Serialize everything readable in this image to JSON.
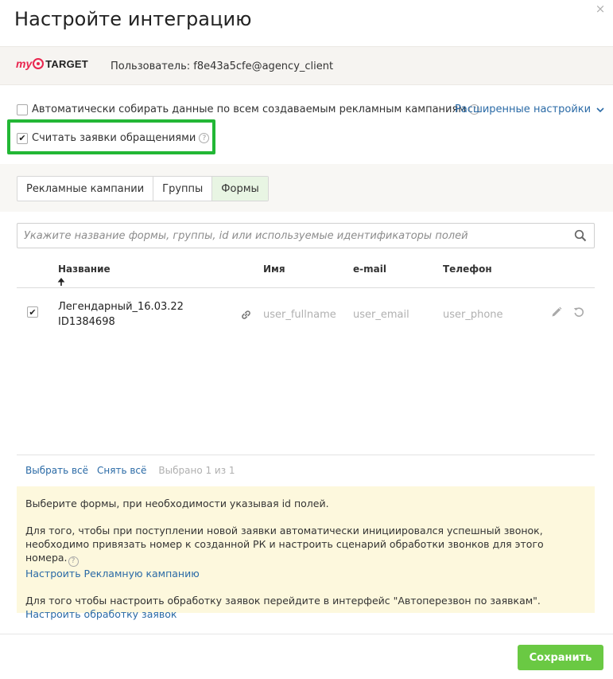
{
  "dialog": {
    "title": "Настройте интеграцию",
    "close": "×"
  },
  "account": {
    "logo_my": "my",
    "logo_target": "TARGET",
    "user_label": "Пользователь: f8e43a5cfe@agency_client"
  },
  "options": {
    "auto_collect": {
      "label": "Автоматически собирать данные по всем создаваемым рекламным кампаниям",
      "checked": false
    },
    "advanced_link": "Расширенные настройки",
    "count_leads": {
      "label": "Считать заявки обращениями",
      "checked": true
    }
  },
  "tabs": [
    {
      "label": "Рекламные кампании",
      "active": false
    },
    {
      "label": "Группы",
      "active": false
    },
    {
      "label": "Формы",
      "active": true
    }
  ],
  "search": {
    "placeholder": "Укажите название формы, группы, id или используемые идентификаторы полей"
  },
  "table": {
    "columns": {
      "name": "Название",
      "name_sort": "🠉",
      "fio": "Имя",
      "email": "e-mail",
      "phone": "Телефон"
    },
    "rows": [
      {
        "checked": true,
        "name": "Легендарный_16.03.22",
        "id": "ID1384698",
        "fio": "user_fullname",
        "email": "user_email",
        "phone": "user_phone"
      }
    ]
  },
  "footer": {
    "select_all": "Выбрать всё",
    "deselect_all": "Снять всё",
    "selected": "Выбрано 1 из 1"
  },
  "note": {
    "p1": "Выберите формы, при необходимости указывая id полей.",
    "p2_line1": "Для того, чтобы при поступлении новой заявки автоматически инициировался успешный звонок,",
    "p2_line2": "необходимо привязать номер к созданной РК и настроить сценарий обработки звонков для этого номера.",
    "p2_link": "Настроить Рекламную кампанию",
    "p3": "Для того чтобы настроить обработку заявок перейдите в интерфейс \"Автоперезвон по заявкам\".",
    "p3_link": "Настроить обработку заявок"
  },
  "save_label": "Сохранить",
  "colors": {
    "accent_green": "#6ac943",
    "highlight_green": "#22b735",
    "link_blue": "#2a6aa6",
    "note_bg": "#fdf8dd"
  }
}
